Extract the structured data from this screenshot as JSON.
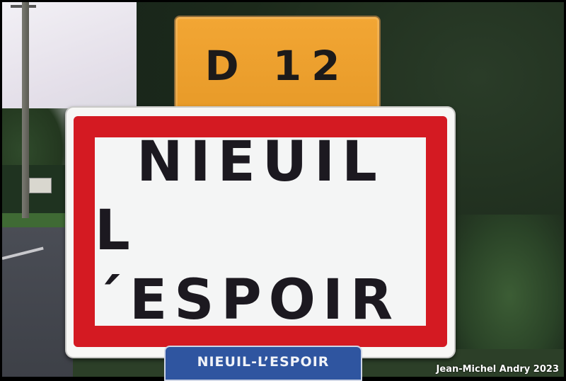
{
  "route_sign": {
    "text": "D 12",
    "color": "#e79a28"
  },
  "town_sign": {
    "line1": "NIEUIL",
    "line2": "L´ESPOIR",
    "border_color": "#d41a22"
  },
  "name_plate": {
    "text": "NIEUIL-L’ESPOIR",
    "color": "#2f55a0"
  },
  "credit": "Jean-Michel Andry 2023"
}
